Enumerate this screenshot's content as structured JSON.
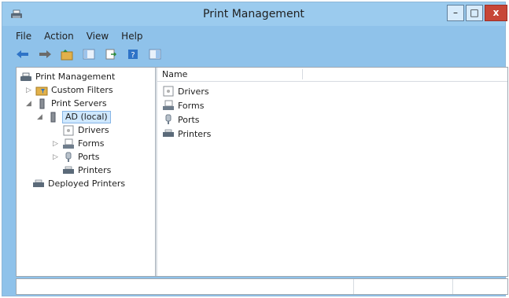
{
  "window": {
    "title": "Print Management"
  },
  "controls": {
    "minimize": "–",
    "maximize": "□",
    "close": "x"
  },
  "menu": {
    "items": [
      "File",
      "Action",
      "View",
      "Help"
    ]
  },
  "toolbar": {
    "icons": [
      "back-arrow-icon",
      "forward-arrow-icon",
      "up-folder-icon",
      "show-hide-tree-icon",
      "export-list-icon",
      "help-icon",
      "properties-icon"
    ]
  },
  "tree": {
    "root": "Print Management",
    "custom_filters": "Custom Filters",
    "print_servers": "Print Servers",
    "server": "AD (local)",
    "drivers": "Drivers",
    "forms": "Forms",
    "ports": "Ports",
    "printers": "Printers",
    "deployed_printers": "Deployed Printers"
  },
  "list": {
    "column_name": "Name",
    "items": [
      "Drivers",
      "Forms",
      "Ports",
      "Printers"
    ]
  }
}
